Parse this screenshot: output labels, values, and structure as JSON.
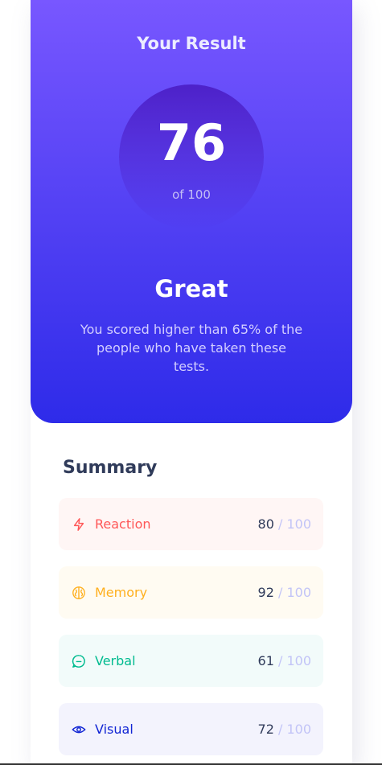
{
  "result": {
    "title": "Your Result",
    "score": "76",
    "max": "of 100",
    "rating": "Great",
    "description": "You scored higher than 65% of the people who have taken these tests."
  },
  "summary": {
    "title": "Summary",
    "items": [
      {
        "label": "Reaction",
        "score": "80",
        "max": " / 100",
        "icon": "lightning-icon",
        "color": "#FF5757"
      },
      {
        "label": "Memory",
        "score": "92",
        "max": " / 100",
        "icon": "brain-icon",
        "color": "#FFB01F"
      },
      {
        "label": "Verbal",
        "score": "61",
        "max": " / 100",
        "icon": "chat-icon",
        "color": "#00BB8F"
      },
      {
        "label": "Visual",
        "score": "72",
        "max": " / 100",
        "icon": "eye-icon",
        "color": "#1125D4"
      }
    ]
  }
}
